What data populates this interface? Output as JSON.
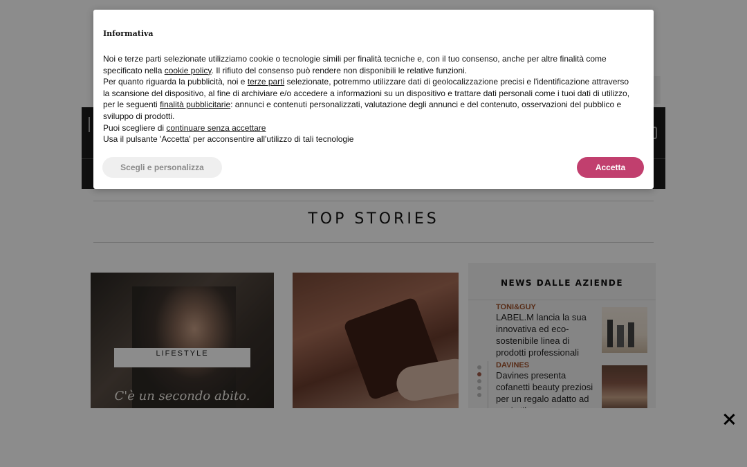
{
  "consent": {
    "title": "Informativa",
    "p1_a": "Noi e terze parti selezionate utilizziamo cookie o tecnologie simili per finalità tecniche e, con il tuo consenso, anche per altre finalità come specificato nella ",
    "p1_link": "cookie policy",
    "p1_b": ". Il rifiuto del consenso può rendere non disponibili le relative funzioni.",
    "p2_a": "Per quanto riguarda la pubblicità, noi e ",
    "p2_link1": "terze parti",
    "p2_b": " selezionate, potremmo utilizzare dati di geolocalizzazione precisi e l'identificazione attraverso la scansione del dispositivo, al fine di archiviare e/o accedere a informazioni su un dispositivo e trattare dati personali come i tuoi dati di utilizzo, per le seguenti ",
    "p2_link2": "finalità pubblicitarie",
    "p2_c": ": annunci e contenuti personalizzati, valutazione degli annunci e del contenuto, osservazioni del pubblico e sviluppo di prodotti.",
    "p3_a": "Puoi scegliere di ",
    "p3_link": "continuare senza accettare",
    "p4": "Usa il pulsante 'Accetta' per acconsentire all'utilizzo di tali tecnologie",
    "customize_label": "Scegli e personalizza",
    "accept_label": "Accetta",
    "accent_color": "#c13f6e"
  },
  "top_stories": {
    "title": "TOP STORIES",
    "card1": {
      "category": "LIFESTYLE",
      "overlay_text": "C'è un secondo abito."
    }
  },
  "sidebar": {
    "title": "NEWS DALLE AZIENDE",
    "items": [
      {
        "brand": "TONI&GUY",
        "text": "LABEL.M lancia la sua innovativa ed eco-sostenibile linea di prodotti professionali"
      },
      {
        "brand": "DAVINES",
        "text": "Davines presenta cofanetti beauty preziosi per un regalo adatto ad ogni stile"
      }
    ]
  },
  "icons": {
    "close": "close-icon"
  }
}
